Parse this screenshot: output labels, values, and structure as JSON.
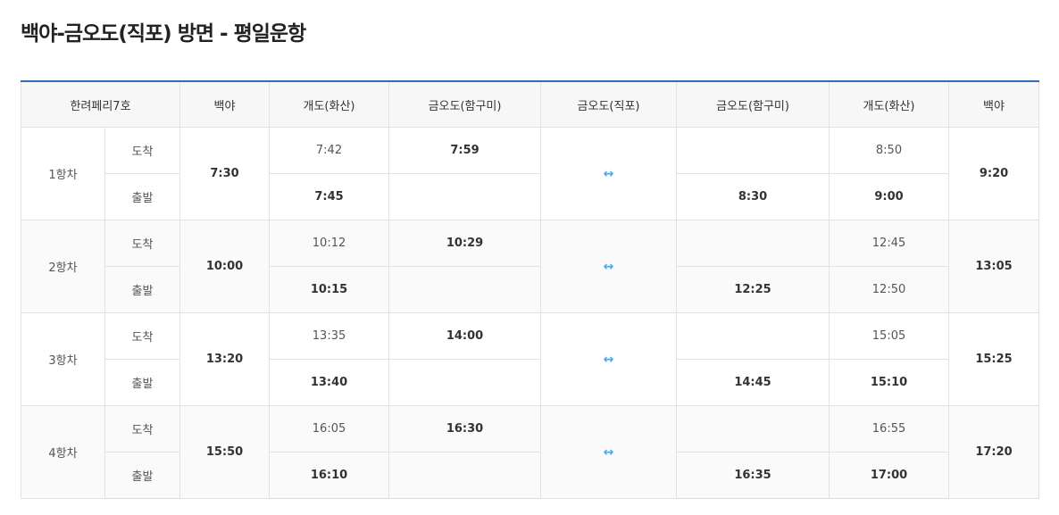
{
  "title": "백야-금오도(직포) 방면 - 평일운항",
  "headers": {
    "ship": "한려페리7호",
    "c1": "백야",
    "c2": "개도(화산)",
    "c3": "금오도(함구미)",
    "c4": "금오도(직포)",
    "c5": "금오도(함구미)",
    "c6": "개도(화산)",
    "c7": "백야"
  },
  "labels": {
    "arrive": "도착",
    "depart": "출발",
    "arrow": "↔"
  },
  "trips": [
    {
      "name": "1항차",
      "baekya_depart": "7:30",
      "gaedo_arrive": "7:42",
      "gaedo_depart": "7:45",
      "hamgumi_arrive": "7:59",
      "hamgumi_return_depart": "8:30",
      "gaedo_return_arrive": "8:50",
      "gaedo_return_depart": "9:00",
      "baekya_arrive": "9:20"
    },
    {
      "name": "2항차",
      "baekya_depart": "10:00",
      "gaedo_arrive": "10:12",
      "gaedo_depart": "10:15",
      "hamgumi_arrive": "10:29",
      "hamgumi_return_depart": "12:25",
      "gaedo_return_arrive": "12:45",
      "gaedo_return_depart": "12:50",
      "baekya_arrive": "13:05"
    },
    {
      "name": "3항차",
      "baekya_depart": "13:20",
      "gaedo_arrive": "13:35",
      "gaedo_depart": "13:40",
      "hamgumi_arrive": "14:00",
      "hamgumi_return_depart": "14:45",
      "gaedo_return_arrive": "15:05",
      "gaedo_return_depart": "15:10",
      "baekya_arrive": "15:25"
    },
    {
      "name": "4항차",
      "baekya_depart": "15:50",
      "gaedo_arrive": "16:05",
      "gaedo_depart": "16:10",
      "hamgumi_arrive": "16:30",
      "hamgumi_return_depart": "16:35",
      "gaedo_return_arrive": "16:55",
      "gaedo_return_depart": "17:00",
      "baekya_arrive": "17:20"
    }
  ],
  "colors": {
    "accent": "#2f6eb5",
    "arrow": "#4aa8e6"
  }
}
